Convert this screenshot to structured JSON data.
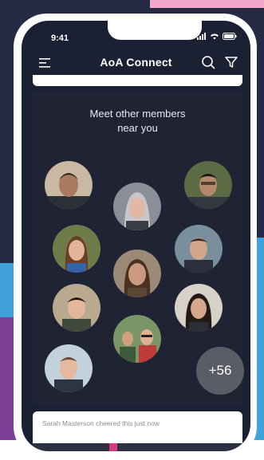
{
  "status_bar": {
    "time": "9:41"
  },
  "app_bar": {
    "title": "AoA Connect"
  },
  "members": {
    "title_line1": "Meet other members",
    "title_line2": "near you",
    "more_count": "+56"
  },
  "feed": {
    "activity_text": "Sarah Masterson cheered this just now"
  },
  "colors": {
    "background": "#252b44",
    "screen": "#1b2033",
    "accent_pink": "#f2a7cc",
    "accent_blue": "#3fa3d9",
    "accent_purple": "#7d3f96"
  }
}
